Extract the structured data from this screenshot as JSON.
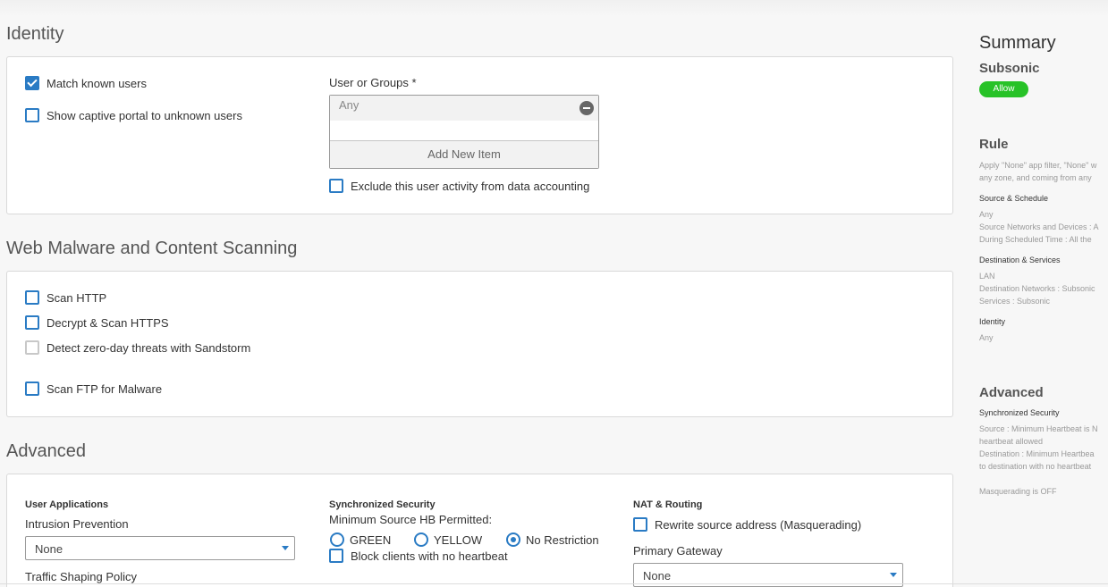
{
  "identity": {
    "title": "Identity",
    "match_known_users": "Match known users",
    "show_captive_portal": "Show captive portal to unknown users",
    "user_groups_label": "User or Groups *",
    "user_groups_item": "Any",
    "add_new_item": "Add New Item",
    "exclude_accounting": "Exclude this user activity from data accounting"
  },
  "web_malware": {
    "title": "Web Malware and Content Scanning",
    "scan_http": "Scan HTTP",
    "decrypt_scan_https": "Decrypt & Scan HTTPS",
    "detect_zero_day": "Detect zero-day threats with Sandstorm",
    "scan_ftp": "Scan FTP for Malware"
  },
  "advanced": {
    "title": "Advanced",
    "user_applications": "User Applications",
    "intrusion_prevention": "Intrusion Prevention",
    "intrusion_prevention_value": "None",
    "traffic_shaping": "Traffic Shaping Policy",
    "sync_security": "Synchronized Security",
    "min_source_hb": "Minimum Source HB Permitted:",
    "radio_green": "GREEN",
    "radio_yellow": "YELLOW",
    "radio_no_restriction": "No Restriction",
    "block_no_heartbeat": "Block clients with no heartbeat",
    "nat_routing": "NAT & Routing",
    "rewrite_source": "Rewrite source address (Masquerading)",
    "primary_gateway": "Primary Gateway",
    "primary_gateway_value": "None"
  },
  "summary": {
    "title": "Summary",
    "rule_name": "Subsonic",
    "status": "Allow",
    "status_color": "#27c227",
    "rule_heading": "Rule",
    "rule_text_1": "Apply \"None\" app filter, \"None\" w",
    "rule_text_2": "any zone, and coming from any",
    "source_schedule": "Source & Schedule",
    "source_any": "Any",
    "source_networks": "Source Networks and Devices : A",
    "scheduled_time": "During Scheduled Time : All the",
    "destination_services": "Destination & Services",
    "dest_lan": "LAN",
    "dest_networks": "Destination Networks : Subsonic",
    "services": "Services : Subsonic",
    "identity": "Identity",
    "identity_any": "Any",
    "advanced_heading": "Advanced",
    "sync_security": "Synchronized Security",
    "sync_text_1": "Source : Minimum Heartbeat is N",
    "sync_text_2": "heartbeat allowed",
    "sync_text_3": "Destination : Minimum Heartbea",
    "sync_text_4": "to destination with no heartbeat",
    "masquerading": "Masquerading is OFF"
  },
  "colors": {
    "accent": "#2a7bc4"
  }
}
